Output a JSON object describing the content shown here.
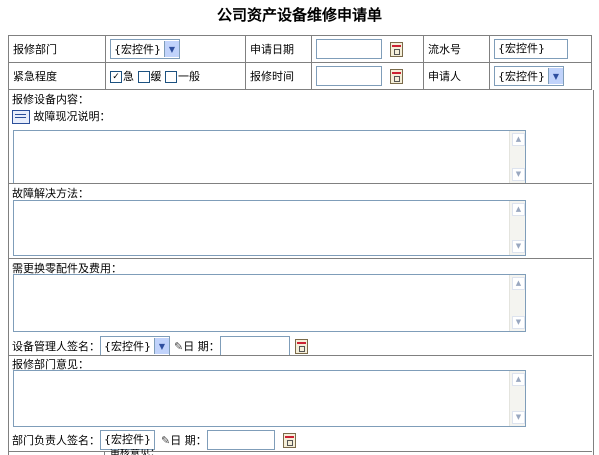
{
  "title": "公司资产设备维修申请单",
  "row1": {
    "dept_label": "报修部门",
    "dept_value": "{宏控件}",
    "date_label": "申请日期",
    "serial_label": "流水号",
    "serial_value": "{宏控件}"
  },
  "row2": {
    "urgency_label": "紧急程度",
    "urgency_options": [
      "急",
      "缓",
      "一般"
    ],
    "urgency_checked": "急",
    "repair_time_label": "报修时间",
    "applicant_label": "申请人",
    "applicant_value": "{宏控件}"
  },
  "content_label": "报修设备内容：",
  "fault_desc_label": "故障现况说明：",
  "solution_label": "故障解决方法：",
  "parts_label": "需更换零配件及费用：",
  "manager_sign": {
    "label": "设备管理人签名：",
    "value": "{宏控件}",
    "date_label": "日 期："
  },
  "dept_opinion_label": "报修部门意见：",
  "head_sign": {
    "label": "部门负责人签名：",
    "value": "{宏控件}",
    "date_label": "日 期："
  },
  "cut_label": "审核意见："
}
